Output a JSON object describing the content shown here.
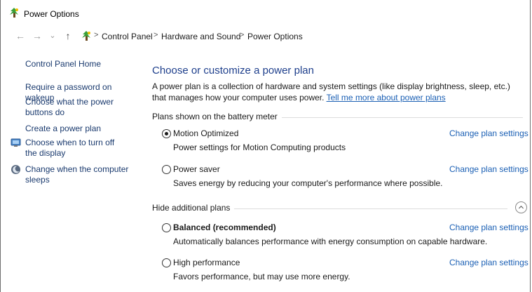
{
  "window": {
    "title": "Power Options",
    "title_icon": "power-options-icon"
  },
  "address": {
    "crumbs": [
      "Control Panel",
      "Hardware and Sound",
      "Power Options"
    ],
    "separator": ">"
  },
  "nav": {
    "back": "←",
    "forward": "→",
    "recent": "⌄",
    "up": "↑"
  },
  "sidebar": {
    "items": [
      {
        "label": "Control Panel Home"
      },
      {
        "label": "Require a password on wakeup"
      },
      {
        "label": "Choose what the power buttons do"
      },
      {
        "label": "Create a power plan"
      },
      {
        "label": "Choose when to turn off the display",
        "icon": "display-icon"
      },
      {
        "label": "Change when the computer sleeps",
        "icon": "moon-icon"
      }
    ]
  },
  "main": {
    "heading": "Choose or customize a power plan",
    "description": "A power plan is a collection of hardware and system settings (like display brightness, sleep, etc.) that manages how your computer uses power. ",
    "description_link": "Tell me more about power plans",
    "battery_section": "Plans shown on the battery meter",
    "additional_section": "Hide additional plans",
    "change_label": "Change plan settings",
    "plans": [
      {
        "name": "Motion Optimized",
        "description": "Power settings for Motion Computing products",
        "selected": true
      },
      {
        "name": "Power saver",
        "description": "Saves energy by reducing your computer's performance where possible.",
        "selected": false
      },
      {
        "name": "Balanced (recommended)",
        "description": "Automatically balances performance with energy consumption on capable hardware.",
        "selected": false
      },
      {
        "name": "High performance",
        "description": "Favors performance, but may use more energy.",
        "selected": false
      }
    ]
  },
  "colors": {
    "link": "#1a5fb4",
    "heading": "#1e3f8c",
    "sidebar_link": "#1a3a6e"
  }
}
